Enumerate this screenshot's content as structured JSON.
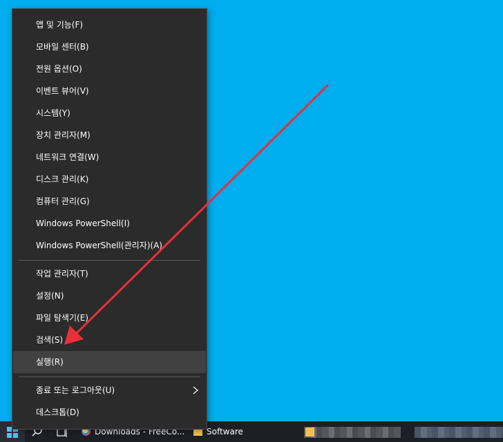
{
  "context_menu": {
    "items_group1": [
      {
        "label": "앱 및 기능(F)"
      },
      {
        "label": "모바일 센터(B)"
      },
      {
        "label": "전원 옵션(O)"
      },
      {
        "label": "이벤트 뷰어(V)"
      },
      {
        "label": "시스템(Y)"
      },
      {
        "label": "장치 관리자(M)"
      },
      {
        "label": "네트워크 연결(W)"
      },
      {
        "label": "디스크 관리(K)"
      },
      {
        "label": "컴퓨터 관리(G)"
      },
      {
        "label": "Windows PowerShell(I)"
      },
      {
        "label": "Windows PowerShell(관리자)(A)"
      }
    ],
    "items_group2": [
      {
        "label": "작업 관리자(T)"
      },
      {
        "label": "설정(N)"
      },
      {
        "label": "파일 탐색기(E)"
      },
      {
        "label": "검색(S)"
      },
      {
        "label": "실행(R)",
        "highlighted": true
      }
    ],
    "items_group3": [
      {
        "label": "종료 또는 로그아웃(U)",
        "has_submenu": true,
        "icon": "chevron-right-icon"
      },
      {
        "label": "데스크톱(D)"
      }
    ]
  },
  "taskbar": {
    "start_icon": "windows-logo-icon",
    "search_icon": "search-icon",
    "task_view_icon": "task-view-icon",
    "apps": [
      {
        "label": "Downloads - FreeCo...",
        "icon": "browser-icon"
      },
      {
        "label": "Software",
        "icon": "folder-icon"
      }
    ]
  },
  "colors": {
    "desktop_background": "#00adef",
    "menu_background": "#2b2b2b",
    "menu_highlight": "#414141",
    "taskbar_background": "#1d1f26",
    "annotation_arrow": "#e8303a"
  }
}
